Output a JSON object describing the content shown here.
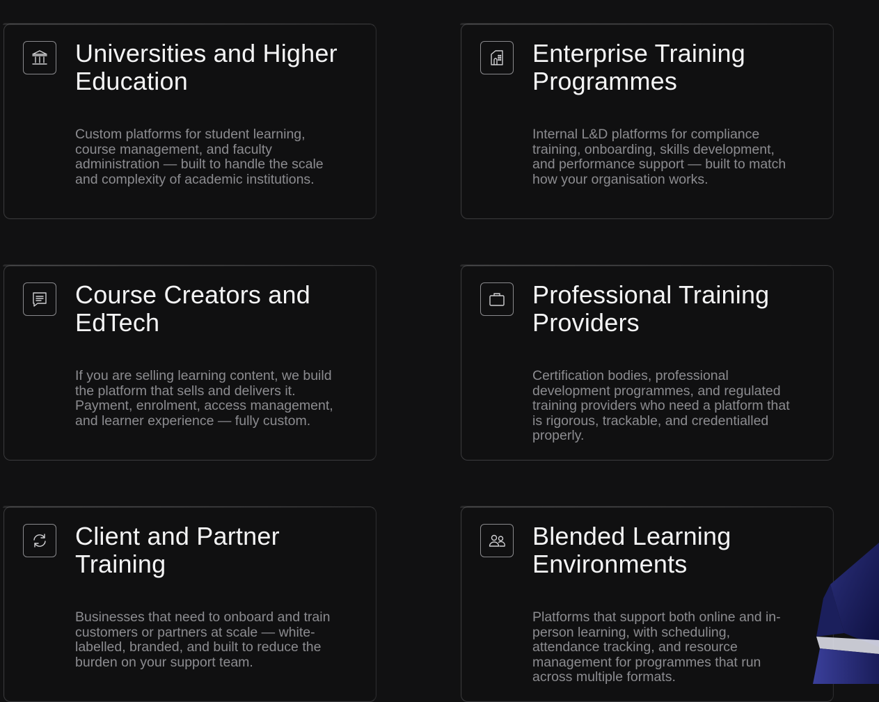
{
  "cards": [
    {
      "icon": "institution-icon",
      "title": "Universities and Higher Education",
      "description": "Custom platforms for student learning, course management, and faculty administration — built to handle the scale and complexity of academic institutions."
    },
    {
      "icon": "building-icon",
      "title": "Enterprise Training Programmes",
      "description": "Internal L&D platforms for compliance training, onboarding, skills development, and performance support — built to match how your organisation works."
    },
    {
      "icon": "chat-icon",
      "title": "Course Creators and EdTech",
      "description": "If you are selling learning content, we build the platform that sells and delivers it. Payment, enrolment, access management, and learner experience — fully custom."
    },
    {
      "icon": "briefcase-icon",
      "title": "Professional Training Providers",
      "description": "Certification bodies, professional development programmes, and regulated training providers who need a platform that is rigorous, trackable, and credentialled properly."
    },
    {
      "icon": "refresh-icon",
      "title": "Client and Partner Training",
      "description": "Businesses that need to onboard and train customers or partners at scale — white-labelled, branded, and built to reduce the burden on your support team."
    },
    {
      "icon": "users-icon",
      "title": "Blended Learning Environments",
      "description": "Platforms that support both online and in-person learning, with scheduling, attendance tracking, and resource management for programmes that run across multiple formats."
    }
  ]
}
